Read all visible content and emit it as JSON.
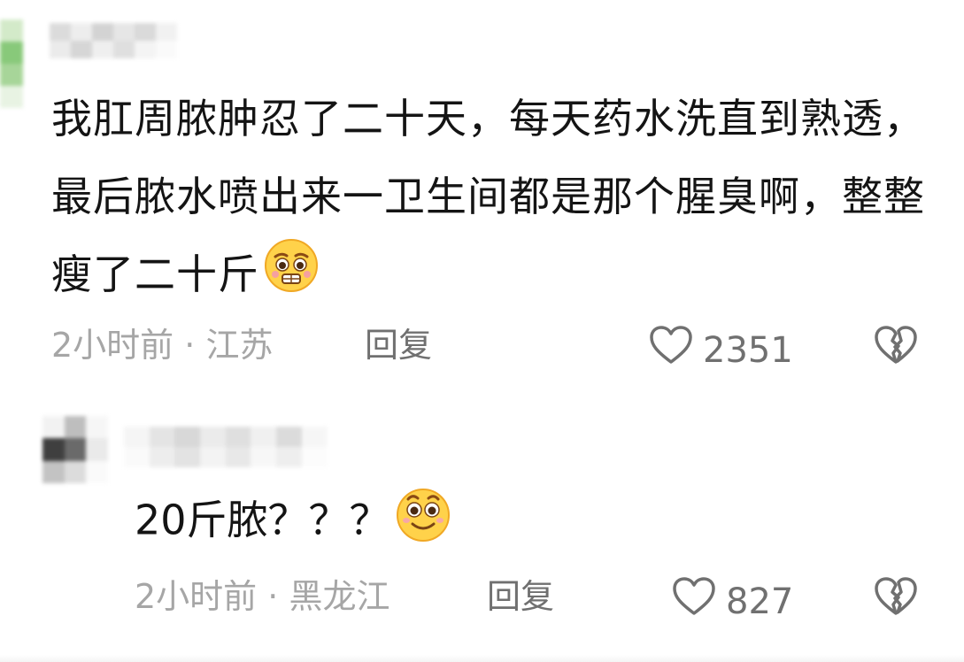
{
  "comments": [
    {
      "text": "我肛周脓肿忍了二十天，每天药水洗直到熟透，最后脓水喷出来一卫生间都是那个腥臭啊，整整瘦了二十斤",
      "emoji": "pleading-face-icon",
      "time": "2小时前",
      "location": "江苏",
      "reply_label": "回复",
      "likes": "2351"
    },
    {
      "text": "20斤脓？？？",
      "emoji": "smiling-face-icon",
      "time": "2小时前",
      "location": "黑龙江",
      "reply_label": "回复",
      "likes": "827"
    }
  ],
  "meta_separator": " · ",
  "colors": {
    "text": "#141414",
    "meta": "#a6a6a6",
    "action": "#707070",
    "emoji_face": "#ffd24a"
  }
}
